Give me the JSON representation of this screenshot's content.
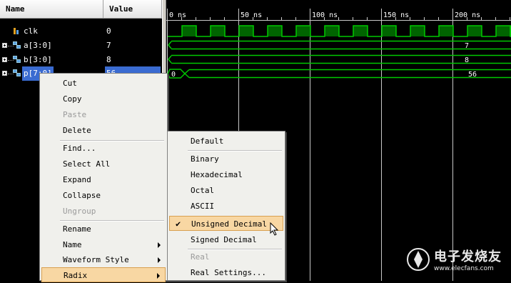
{
  "columns": {
    "name": "Name",
    "value": "Value"
  },
  "signals": [
    {
      "name": "clk",
      "value": "0"
    },
    {
      "name": "a[3:0]",
      "value": "7"
    },
    {
      "name": "b[3:0]",
      "value": "8"
    },
    {
      "name": "p[7:0]",
      "value": "56"
    }
  ],
  "timeline": [
    "0 ns",
    "50 ns",
    "100 ns",
    "150 ns",
    "200 ns"
  ],
  "waveform_values": {
    "a": "7",
    "b": "8",
    "p_initial": "0",
    "p": "56"
  },
  "context_menu": {
    "items": [
      {
        "label": "Cut",
        "enabled": true,
        "submenu": false
      },
      {
        "label": "Copy",
        "enabled": true,
        "submenu": false
      },
      {
        "label": "Paste",
        "enabled": false,
        "submenu": false
      },
      {
        "label": "Delete",
        "enabled": true,
        "submenu": false
      },
      {
        "label": "Find...",
        "enabled": true,
        "submenu": false
      },
      {
        "label": "Select All",
        "enabled": true,
        "submenu": false
      },
      {
        "label": "Expand",
        "enabled": true,
        "submenu": false
      },
      {
        "label": "Collapse",
        "enabled": true,
        "submenu": false
      },
      {
        "label": "Ungroup",
        "enabled": false,
        "submenu": false
      },
      {
        "label": "Rename",
        "enabled": true,
        "submenu": false
      },
      {
        "label": "Name",
        "enabled": true,
        "submenu": true
      },
      {
        "label": "Waveform Style",
        "enabled": true,
        "submenu": true
      },
      {
        "label": "Radix",
        "enabled": true,
        "submenu": true,
        "highlighted": true
      }
    ]
  },
  "radix_menu": {
    "items": [
      {
        "label": "Default",
        "enabled": true
      },
      {
        "label": "Binary",
        "enabled": true
      },
      {
        "label": "Hexadecimal",
        "enabled": true
      },
      {
        "label": "Octal",
        "enabled": true
      },
      {
        "label": "ASCII",
        "enabled": true
      },
      {
        "label": "Unsigned Decimal",
        "enabled": true,
        "checked": true,
        "highlighted": true
      },
      {
        "label": "Signed Decimal",
        "enabled": true
      },
      {
        "label": "Real",
        "enabled": false
      },
      {
        "label": "Real Settings...",
        "enabled": true
      }
    ]
  },
  "watermark": {
    "brand": "电子发烧友",
    "url": "www.elecfans.com"
  },
  "colors": {
    "wave": "#00c800",
    "clk_fill": "#006400",
    "selection": "#3a6bd1",
    "highlight": "#f8d7a3"
  }
}
